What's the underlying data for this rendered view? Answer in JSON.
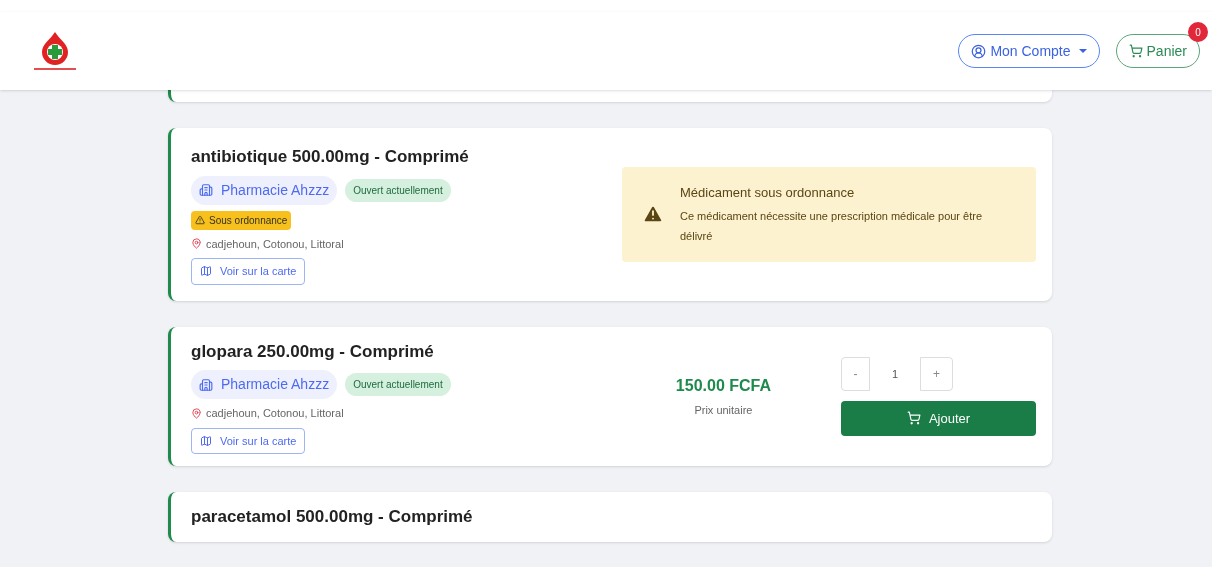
{
  "header": {
    "account_button": "Mon Compte",
    "cart_button": "Panier",
    "cart_count": "0"
  },
  "products": [
    {
      "kind": "prescription",
      "title": "antibiotique 500.00mg - Comprimé",
      "pharmacy": "Pharmacie Ahzzz",
      "status": "Ouvert actuellement",
      "prescription_badge": "Sous ordonnance",
      "address": "cadjehoun, Cotonou, Littoral",
      "map_link": "Voir sur la carte",
      "notice_title": "Médicament sous ordonnance",
      "notice_text": "Ce médicament nécessite une prescription médicale pour être délivré"
    },
    {
      "kind": "purchase",
      "title": "glopara 250.00mg - Comprimé",
      "pharmacy": "Pharmacie Ahzzz",
      "status": "Ouvert actuellement",
      "address": "cadjehoun, Cotonou, Littoral",
      "map_link": "Voir sur la carte",
      "price": "150.00 FCFA",
      "price_label": "Prix unitaire",
      "minus": "-",
      "quantity": "1",
      "plus": "+",
      "add_button": "Ajouter"
    },
    {
      "kind": "cut",
      "title": "paracetamol 500.00mg - Comprimé"
    }
  ]
}
